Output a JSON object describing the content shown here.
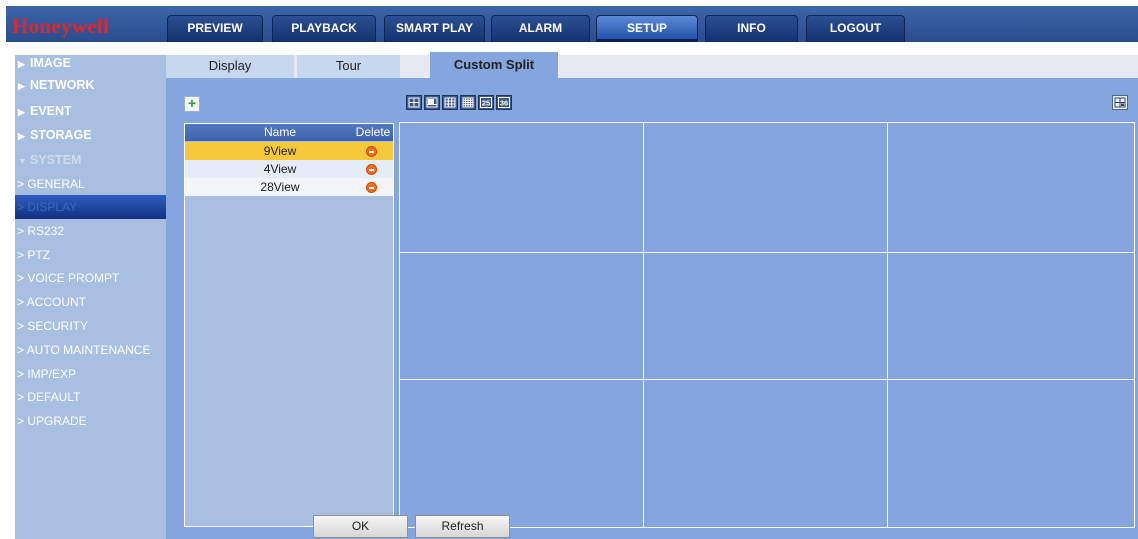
{
  "brand": {
    "logo": "Honeywell"
  },
  "nav": {
    "items": [
      {
        "label": "PREVIEW"
      },
      {
        "label": "PLAYBACK"
      },
      {
        "label": "SMART PLAY"
      },
      {
        "label": "ALARM"
      },
      {
        "label": "SETUP",
        "active": true
      },
      {
        "label": "INFO"
      },
      {
        "label": "LOGOUT"
      }
    ]
  },
  "sidebar": {
    "categories": [
      {
        "label": "IMAGE",
        "icon": "triangle-right-icon"
      },
      {
        "label": "NETWORK",
        "icon": "triangle-right-icon"
      },
      {
        "label": "EVENT",
        "icon": "triangle-right-icon"
      },
      {
        "label": "STORAGE",
        "icon": "triangle-right-icon"
      },
      {
        "label": "SYSTEM",
        "icon": "triangle-down-icon",
        "expanded": true
      }
    ],
    "sub_items": [
      {
        "label": "> GENERAL"
      },
      {
        "label": "> DISPLAY",
        "selected": true
      },
      {
        "label": "> RS232"
      },
      {
        "label": "> PTZ"
      },
      {
        "label": "> VOICE PROMPT"
      },
      {
        "label": "> ACCOUNT"
      },
      {
        "label": "> SECURITY"
      },
      {
        "label": "> AUTO MAINTENANCE"
      },
      {
        "label": "> IMP/EXP"
      },
      {
        "label": "> DEFAULT"
      },
      {
        "label": "> UPGRADE"
      }
    ]
  },
  "tabs": [
    {
      "label": "Display"
    },
    {
      "label": "Tour"
    },
    {
      "label": "Custom Split",
      "active": true
    }
  ],
  "toolbar": {
    "add_icon": "plus-icon",
    "split_buttons": [
      {
        "icon": "split-4-icon"
      },
      {
        "icon": "split-6-icon"
      },
      {
        "icon": "split-9-icon"
      },
      {
        "icon": "split-16-icon"
      },
      {
        "icon": "split-25-icon",
        "label": "25"
      },
      {
        "icon": "split-36-icon",
        "label": "36"
      }
    ],
    "fit_icon": "fit-view-icon"
  },
  "split_list": {
    "headers": {
      "name": "Name",
      "delete": "Delete"
    },
    "rows": [
      {
        "name": "9View",
        "selected": true
      },
      {
        "name": "4View"
      },
      {
        "name": "28View"
      }
    ]
  },
  "grid": {
    "rows": 3,
    "cols": 3
  },
  "buttons": {
    "ok": "OK",
    "refresh": "Refresh"
  },
  "colors": {
    "topbar": "#2a4c8d",
    "logo": "#e3262b",
    "content_bg": "#84a5dd",
    "sidebar_bg": "#a8bfe1",
    "row_selected": "#f5c93a",
    "delete_icon": "#f26d1c"
  }
}
